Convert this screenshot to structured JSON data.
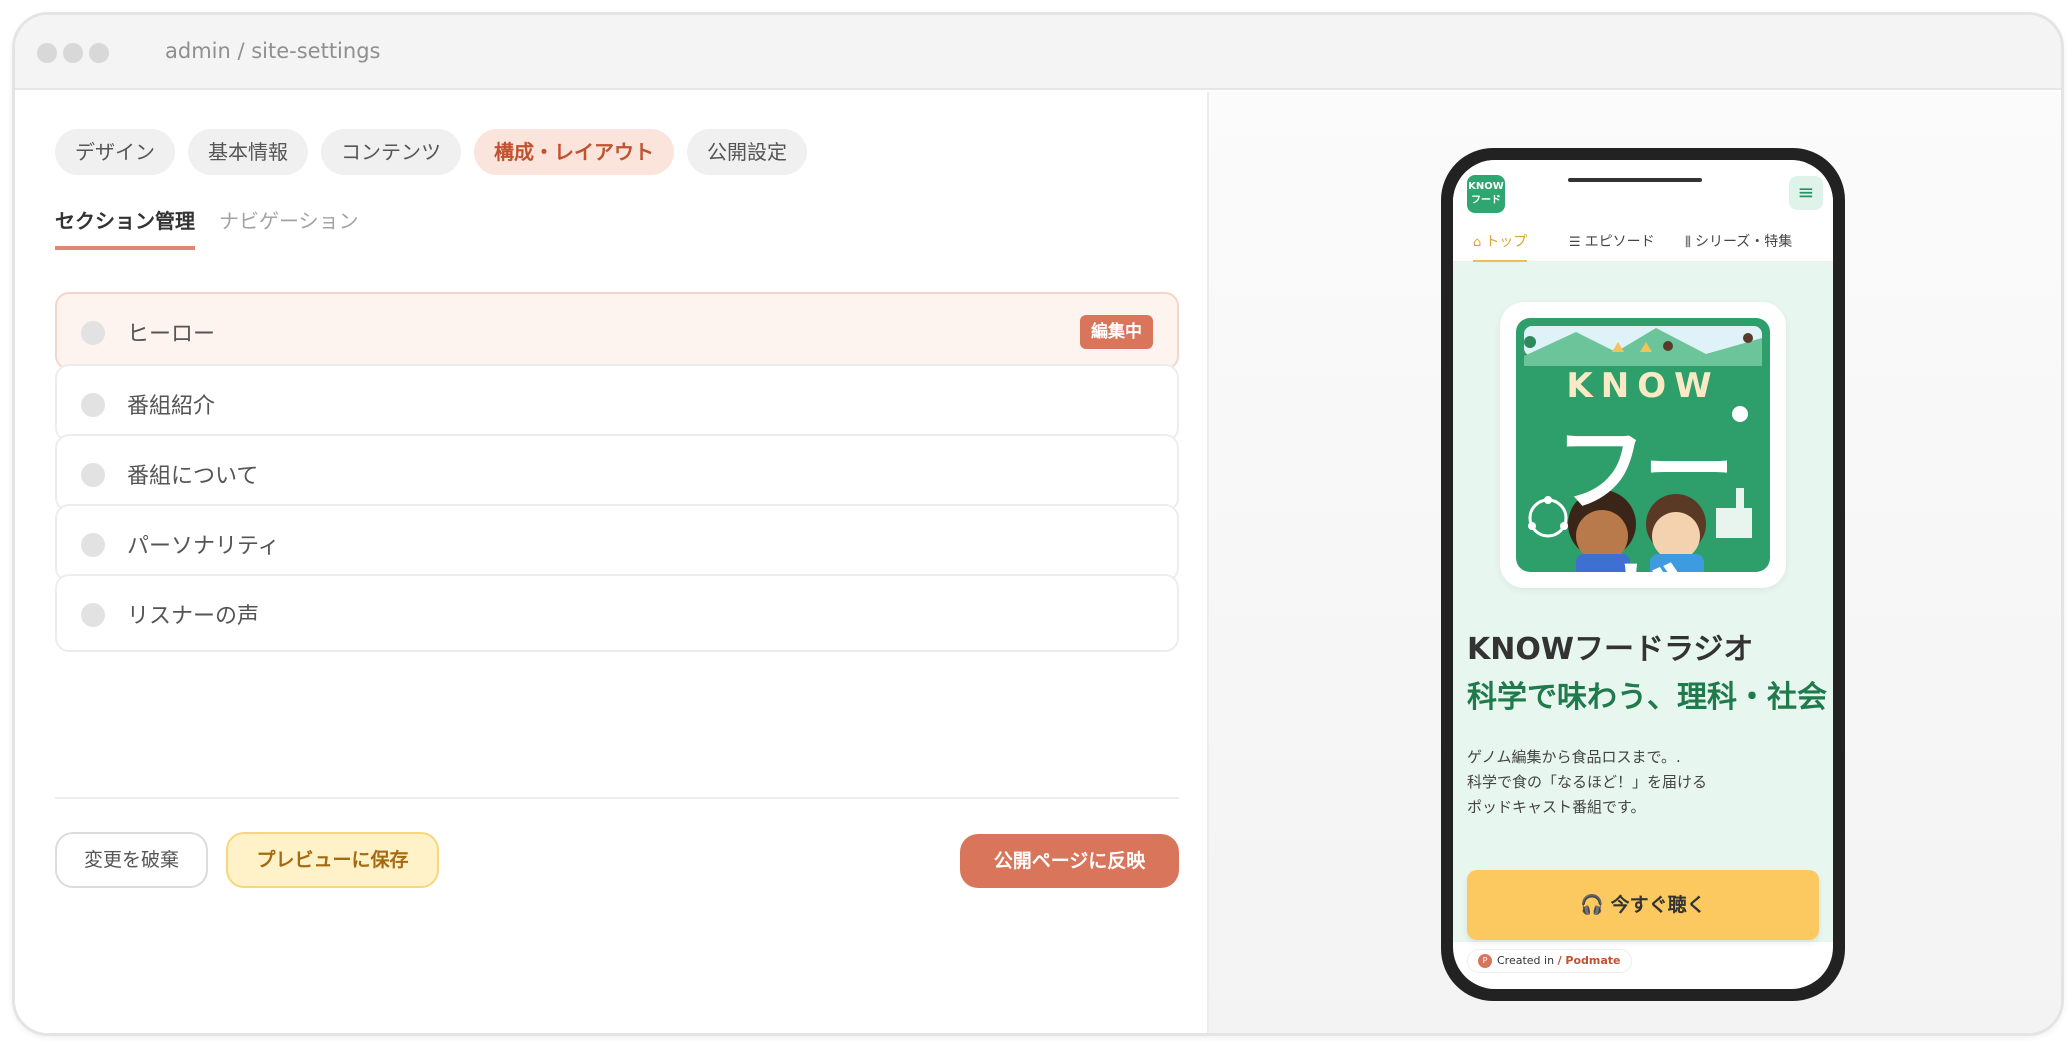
{
  "window": {
    "title": "admin / site-settings"
  },
  "tabs": [
    {
      "label": "デザイン"
    },
    {
      "label": "基本情報"
    },
    {
      "label": "コンテンツ"
    },
    {
      "label": "構成・レイアウト"
    },
    {
      "label": "公開設定"
    }
  ],
  "subtabs": [
    {
      "label": "セクション管理"
    },
    {
      "label": "ナビゲーション"
    }
  ],
  "sections": [
    {
      "label": "ヒーロー",
      "badge": "編集中"
    },
    {
      "label": "番組紹介"
    },
    {
      "label": "番組について"
    },
    {
      "label": "パーソナリティ"
    },
    {
      "label": "リスナーの声"
    }
  ],
  "actions": {
    "discard": "変更を破棄",
    "save_preview": "プレビューに保存",
    "publish": "公開ページに反映"
  },
  "preview": {
    "logo_text": "KNOW フード",
    "nav": [
      {
        "label": "トップ",
        "icon": "home-icon"
      },
      {
        "label": "エピソード",
        "icon": "playlist-icon"
      },
      {
        "label": "シリーズ・特集",
        "icon": "library-icon"
      }
    ],
    "artwork": {
      "line1": "KNOW",
      "line2": "フード"
    },
    "title": "KNOWフードラジオ",
    "subtitle": "科学で味わう、理科・社会",
    "description": [
      "ゲノム編集から食品ロスまで。.",
      "科学で食の「なるほど！」を届ける",
      "ポッドキャスト番組です。"
    ],
    "cta": "今すぐ聴く",
    "footer_prefix": "Created in",
    "footer_brand": "/ Podmate",
    "footer_logo": "P"
  },
  "colors": {
    "accent": "#d9755b",
    "active_tab_bg": "#fbe4dc",
    "preview_green": "#1f7a4c",
    "cta_yellow": "#fcc960"
  }
}
